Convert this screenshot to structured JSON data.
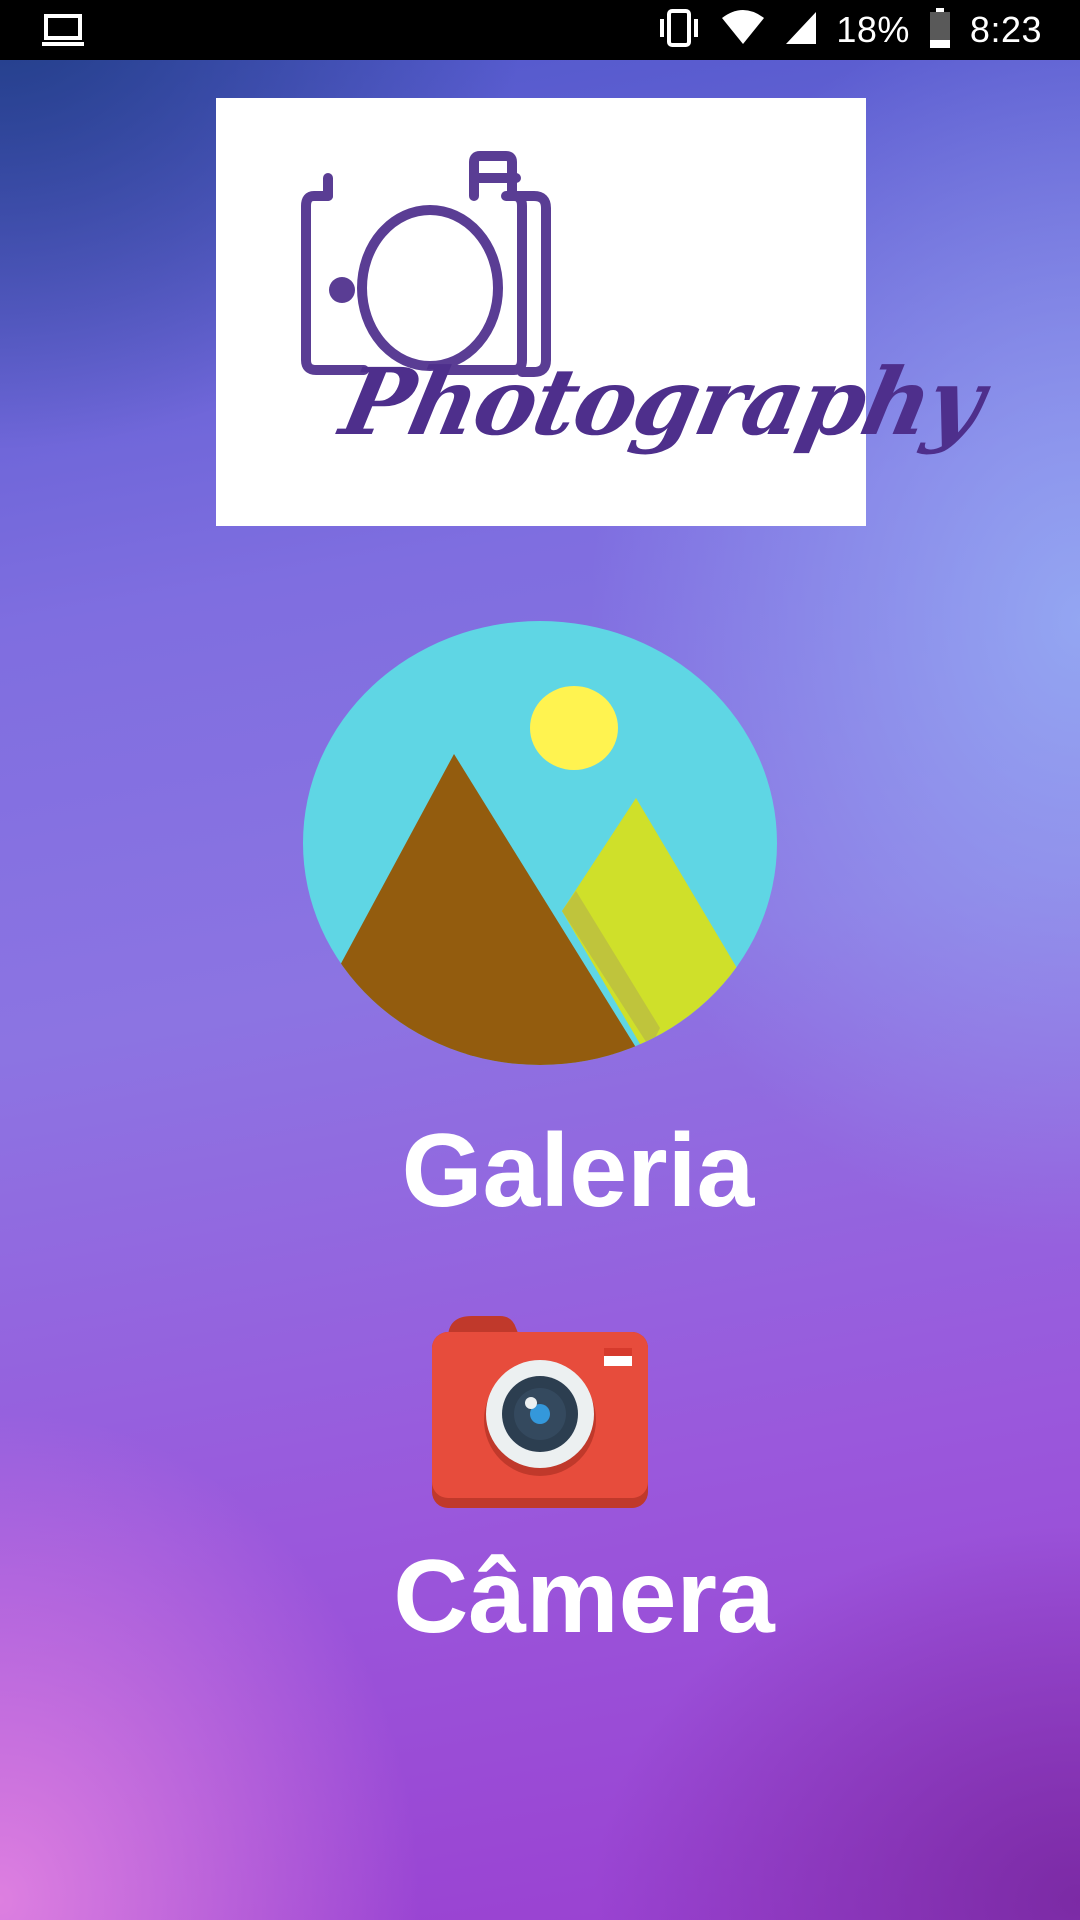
{
  "status_bar": {
    "left_icon": "laptop-icon",
    "icons": [
      "vibrate-icon",
      "wifi-icon",
      "cell-signal-icon",
      "battery-icon"
    ],
    "battery_percent": "18%",
    "time": "8:23"
  },
  "logo": {
    "icon": "camera-outline-icon",
    "text": "Photography",
    "color": "#4e2f8c"
  },
  "gallery": {
    "icon": "landscape-image-icon",
    "label": "Galeria"
  },
  "camera": {
    "icon": "camera-icon",
    "label": "Câmera",
    "color": "#e74c3c"
  }
}
